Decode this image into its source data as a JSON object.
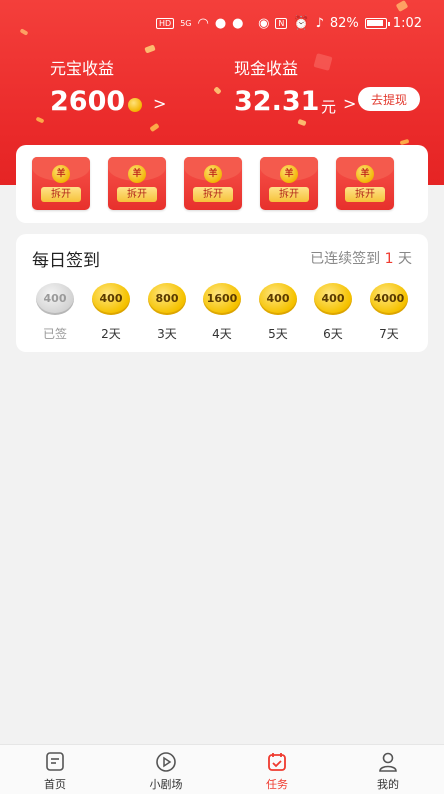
{
  "status_bar": {
    "hd": "HD",
    "signal": "5G",
    "battery_percent": "82%",
    "time": "1:02"
  },
  "earnings": {
    "coins": {
      "label": "元宝收益",
      "value": "2600",
      "chevron": ">"
    },
    "cash": {
      "label": "现金收益",
      "value": "32.31",
      "unit": "元",
      "chevron": ">",
      "withdraw_label": "去提现"
    }
  },
  "red_envelopes": [
    {
      "seal": "羊",
      "action": "拆开"
    },
    {
      "seal": "羊",
      "action": "拆开"
    },
    {
      "seal": "羊",
      "action": "拆开"
    },
    {
      "seal": "羊",
      "action": "拆开"
    },
    {
      "seal": "羊",
      "action": "拆开"
    }
  ],
  "checkin": {
    "title": "每日签到",
    "streak_prefix": "已连续签到",
    "streak_days": "1",
    "streak_suffix": "天",
    "days": [
      {
        "amount": "400",
        "label": "已签",
        "done": true
      },
      {
        "amount": "400",
        "label": "2天",
        "done": false
      },
      {
        "amount": "800",
        "label": "3天",
        "done": false
      },
      {
        "amount": "1600",
        "label": "4天",
        "done": false
      },
      {
        "amount": "400",
        "label": "5天",
        "done": false
      },
      {
        "amount": "400",
        "label": "6天",
        "done": false
      },
      {
        "amount": "4000",
        "label": "7天",
        "done": false
      }
    ]
  },
  "tabbar": {
    "items": [
      {
        "label": "首页",
        "icon": "home-note-icon",
        "active": false
      },
      {
        "label": "小剧场",
        "icon": "play-icon",
        "active": false
      },
      {
        "label": "任务",
        "icon": "calendar-check-icon",
        "active": true
      },
      {
        "label": "我的",
        "icon": "person-icon",
        "active": false
      }
    ]
  },
  "colors": {
    "accent": "#ef3a2f",
    "header_red": "#ea2a2a",
    "coin_gold": "#f5c200"
  }
}
